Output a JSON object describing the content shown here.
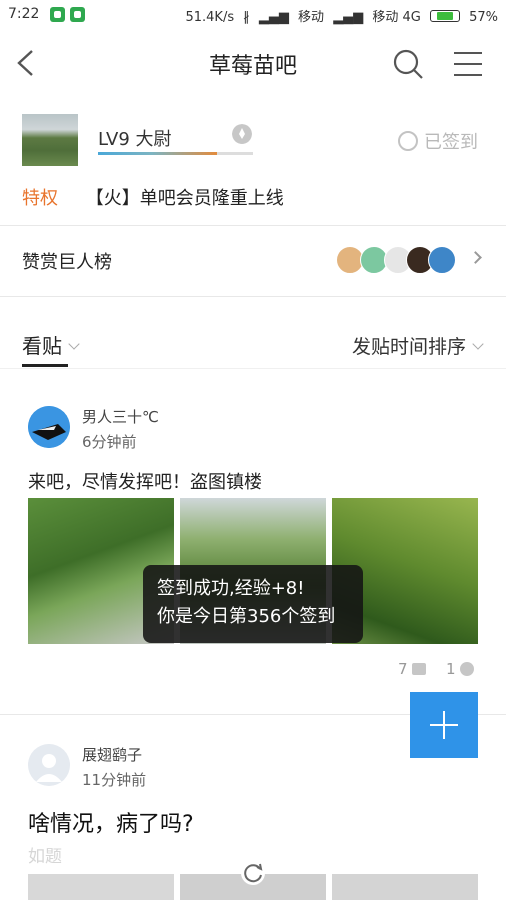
{
  "status_bar": {
    "time": "7:22",
    "net_speed": "51.4K/s",
    "carrier1": "移动",
    "carrier2": "移动 4G",
    "battery": "57%",
    "battery_level": 0.57
  },
  "header": {
    "title": "草莓苗吧",
    "icons": [
      "back-icon",
      "search-icon",
      "menu-icon"
    ]
  },
  "forum": {
    "level": "LV9 大尉",
    "level_progress": 0.77,
    "signed_label": "已签到",
    "privilege_tag": "特权",
    "privilege_text": "【火】单吧会员隆重上线"
  },
  "reward": {
    "label": "赞赏巨人榜"
  },
  "tabs": {
    "view_label": "看贴",
    "sort_label": "发贴时间排序"
  },
  "posts": [
    {
      "author": "男人三十℃",
      "time": "6分钟前",
      "title": "来吧，尽情发挥吧！盗图镇楼",
      "comments": "7",
      "likes": "1"
    },
    {
      "author": "展翅鹞子",
      "time": "11分钟前",
      "title": "啥情况，病了吗?",
      "tag": "如题"
    }
  ],
  "toast": {
    "line1": "签到成功,经验+8!",
    "line2": "你是今日第356个签到"
  },
  "colors": {
    "accent_orange": "#e8742d",
    "fab_blue": "#2f93e8",
    "toast_bg": "#141414"
  }
}
